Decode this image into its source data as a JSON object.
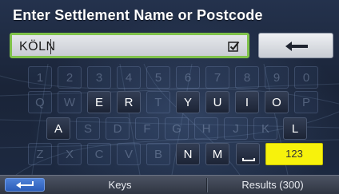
{
  "header": {
    "title": "Enter Settlement Name or Postcode"
  },
  "input": {
    "value": "KÖLN"
  },
  "keyboard": {
    "rows": [
      [
        {
          "label": "1",
          "enabled": false
        },
        {
          "label": "2",
          "enabled": false
        },
        {
          "label": "3",
          "enabled": false
        },
        {
          "label": "4",
          "enabled": false
        },
        {
          "label": "5",
          "enabled": false
        },
        {
          "label": "6",
          "enabled": false
        },
        {
          "label": "7",
          "enabled": false
        },
        {
          "label": "8",
          "enabled": false
        },
        {
          "label": "9",
          "enabled": false
        },
        {
          "label": "0",
          "enabled": false
        }
      ],
      [
        {
          "label": "Q",
          "enabled": false
        },
        {
          "label": "W",
          "enabled": false
        },
        {
          "label": "E",
          "enabled": true
        },
        {
          "label": "R",
          "enabled": true
        },
        {
          "label": "T",
          "enabled": false
        },
        {
          "label": "Y",
          "enabled": true
        },
        {
          "label": "U",
          "enabled": true
        },
        {
          "label": "I",
          "enabled": true
        },
        {
          "label": "O",
          "enabled": true
        },
        {
          "label": "P",
          "enabled": false
        }
      ],
      [
        {
          "label": "A",
          "enabled": true
        },
        {
          "label": "S",
          "enabled": false
        },
        {
          "label": "D",
          "enabled": false
        },
        {
          "label": "F",
          "enabled": false
        },
        {
          "label": "G",
          "enabled": false
        },
        {
          "label": "H",
          "enabled": false
        },
        {
          "label": "J",
          "enabled": false
        },
        {
          "label": "K",
          "enabled": false
        },
        {
          "label": "L",
          "enabled": true
        }
      ],
      [
        {
          "label": "Z",
          "enabled": false
        },
        {
          "label": "X",
          "enabled": false
        },
        {
          "label": "C",
          "enabled": false
        },
        {
          "label": "V",
          "enabled": false
        },
        {
          "label": "B",
          "enabled": false
        },
        {
          "label": "N",
          "enabled": true
        },
        {
          "label": "M",
          "enabled": true
        }
      ]
    ],
    "space_icon": "space-bar-icon",
    "numeric_label": "123",
    "numeric_color": "#f7f20c"
  },
  "icons": {
    "backspace": "left-arrow-icon",
    "checkbox": "checkbox-checked-icon",
    "back": "return-arrow-icon"
  },
  "footer": {
    "keys_label": "Keys",
    "results_label": "Results (300)"
  }
}
